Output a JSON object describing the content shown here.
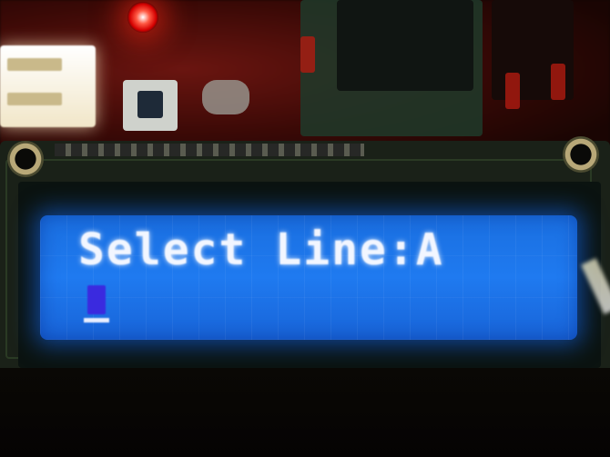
{
  "lcd": {
    "line1": "Select Line:A",
    "line2": ""
  },
  "colors": {
    "lcd_backlight": "#1f7af0",
    "lcd_text": "#f2f6ff",
    "cursor": "#3a2adf",
    "led": "#ff2a1a"
  }
}
